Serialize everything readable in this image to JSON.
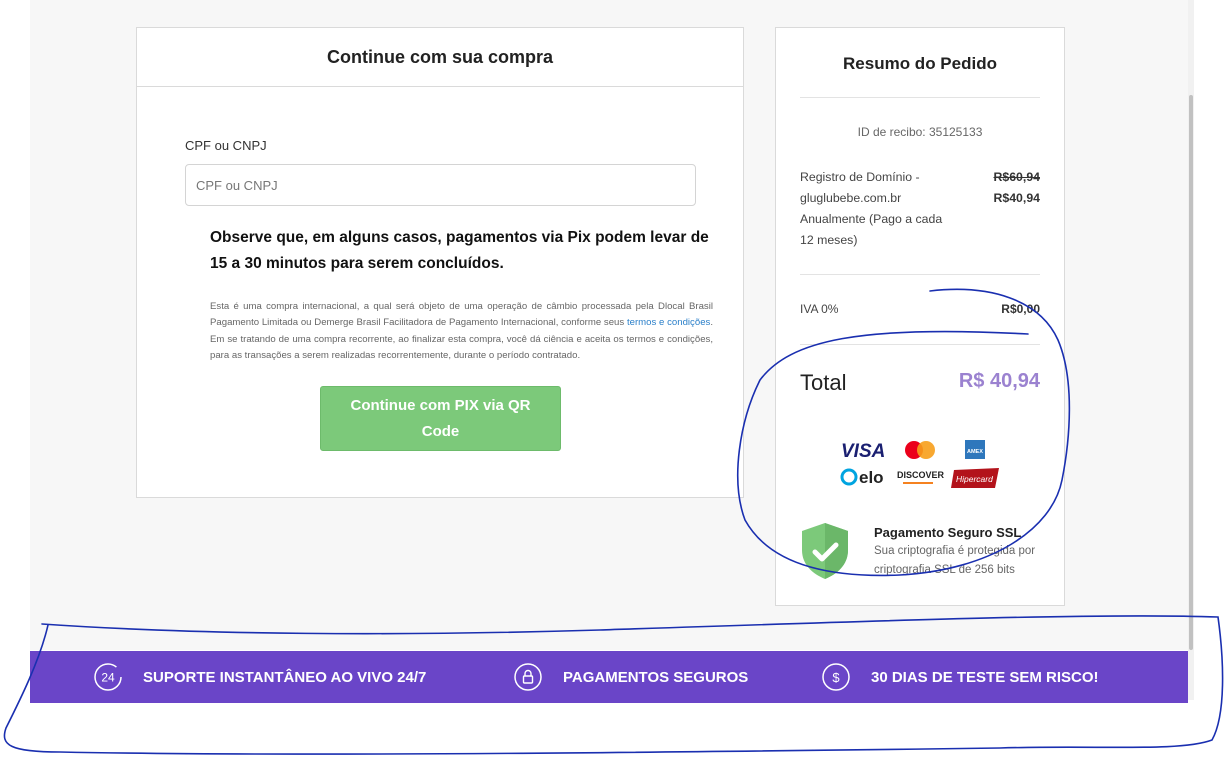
{
  "checkout": {
    "title": "Continue com sua compra",
    "document_label": "CPF ou CNPJ",
    "document_placeholder": "CPF ou CNPJ",
    "notice": "Observe que, em alguns casos, pagamentos via Pix podem levar de 15 a 30 minutos para serem concluídos.",
    "legal_part1": "Esta é uma compra internacional, a qual será objeto de uma operação de câmbio processada pela Dlocal Brasil Pagamento Limitada ou Demerge Brasil Facilitadora de Pagamento Internacional, conforme seus ",
    "legal_link": "termos e condições",
    "legal_part2": ". Em se tratando de uma compra recorrente, ao finalizar esta compra, você dá ciência e aceita os termos e condições, para as transações a serem realizadas recorrentemente, durante o período contratado.",
    "pix_button": "Continue com PIX via QR Code"
  },
  "summary": {
    "title": "Resumo do Pedido",
    "receipt_id": "ID de recibo: 35125133",
    "item_line1": "Registro de Domínio -",
    "item_line2": "gluglubebe.com.br",
    "item_line3": "Anualmente (Pago a cada",
    "item_line4": "12 meses)",
    "item_old_price": "R$60,94",
    "item_price": "R$40,94",
    "vat_label": "IVA 0%",
    "vat_value": "R$0,00",
    "total_label": "Total",
    "total_value": "R$ 40,94",
    "card_brands": [
      "VISA",
      "Mastercard",
      "AMEX",
      "elo",
      "DISCOVER",
      "Hipercard"
    ],
    "ssl_title": "Pagamento Seguro SSL",
    "ssl_desc": "Sua criptografia é protegida por criptografia SSL de 256 bits"
  },
  "footer": {
    "features": [
      {
        "icon": "support-24-icon",
        "label": "SUPORTE INSTANTÂNEO AO VIVO 24/7"
      },
      {
        "icon": "lock-icon",
        "label": "PAGAMENTOS SEGUROS"
      },
      {
        "icon": "dollar-icon",
        "label": "30 DIAS DE TESTE SEM RISCO!"
      }
    ]
  },
  "colors": {
    "footer_bg": "#6a45c8",
    "pix_button": "#7cc97a",
    "total_value": "#9b82d0",
    "annotation_ink": "#1a2fb0"
  }
}
